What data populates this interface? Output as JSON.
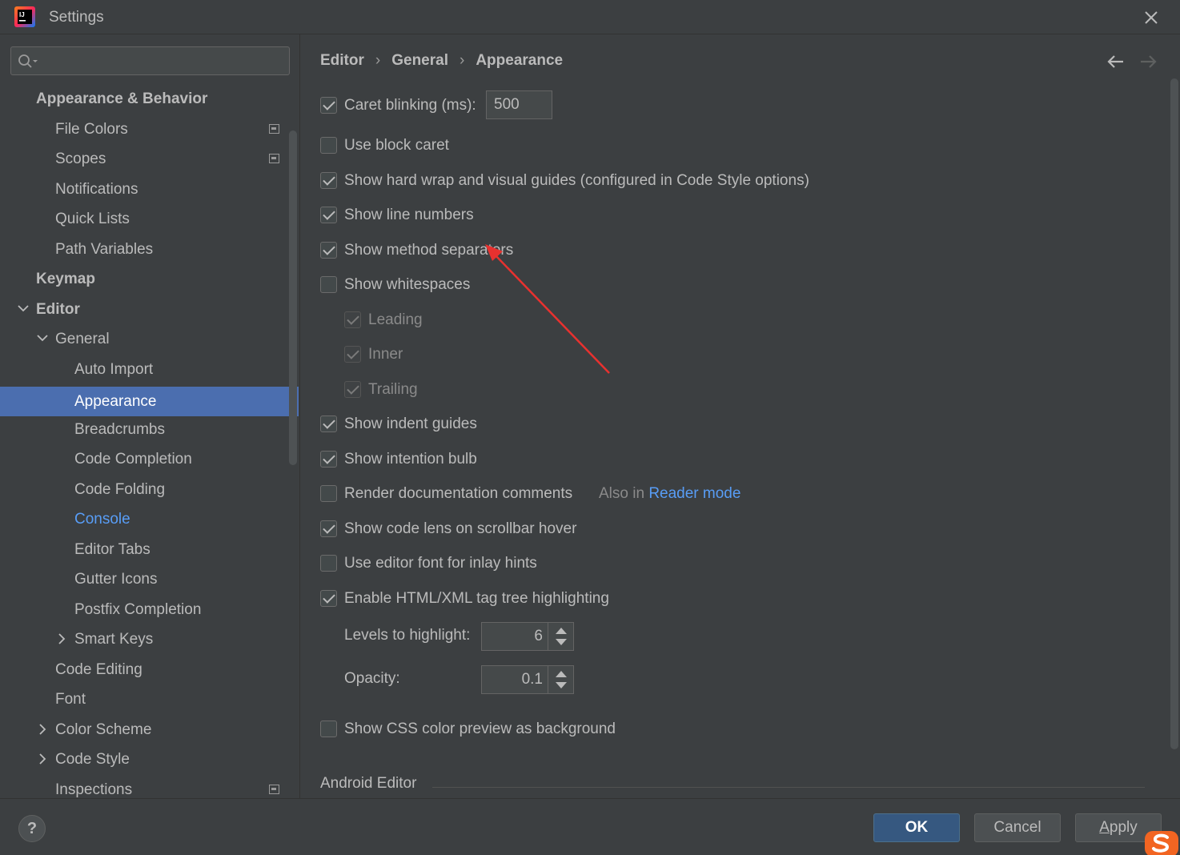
{
  "window": {
    "title": "Settings"
  },
  "sidebar": {
    "search_placeholder": "",
    "items": [
      {
        "label": "Appearance & Behavior",
        "level": 0,
        "bold": true
      },
      {
        "label": "File Colors",
        "level": 1,
        "project_icon": true
      },
      {
        "label": "Scopes",
        "level": 1,
        "project_icon": true
      },
      {
        "label": "Notifications",
        "level": 1
      },
      {
        "label": "Quick Lists",
        "level": 1
      },
      {
        "label": "Path Variables",
        "level": 1
      },
      {
        "label": "Keymap",
        "level": 0,
        "bold": true
      },
      {
        "label": "Editor",
        "level": 0,
        "bold": true,
        "expanded": true
      },
      {
        "label": "General",
        "level": 1,
        "expanded": true
      },
      {
        "label": "Auto Import",
        "level": 2
      },
      {
        "label": "Appearance",
        "level": 2,
        "selected": true
      },
      {
        "label": "Breadcrumbs",
        "level": 2
      },
      {
        "label": "Code Completion",
        "level": 2
      },
      {
        "label": "Code Folding",
        "level": 2
      },
      {
        "label": "Console",
        "level": 2,
        "link": true
      },
      {
        "label": "Editor Tabs",
        "level": 2
      },
      {
        "label": "Gutter Icons",
        "level": 2
      },
      {
        "label": "Postfix Completion",
        "level": 2
      },
      {
        "label": "Smart Keys",
        "level": 2,
        "collapsed": true
      },
      {
        "label": "Code Editing",
        "level": 1
      },
      {
        "label": "Font",
        "level": 1
      },
      {
        "label": "Color Scheme",
        "level": 1,
        "collapsed": true
      },
      {
        "label": "Code Style",
        "level": 1,
        "collapsed": true
      },
      {
        "label": "Inspections",
        "level": 1,
        "project_icon": true
      }
    ]
  },
  "breadcrumb": {
    "parts": [
      "Editor",
      "General",
      "Appearance"
    ],
    "separator": "›"
  },
  "options": {
    "caret_blinking": {
      "label": "Caret blinking (ms):",
      "checked": true,
      "value": "500"
    },
    "use_block_caret": {
      "label": "Use block caret",
      "checked": false
    },
    "hard_wrap": {
      "label": "Show hard wrap and visual guides (configured in Code Style options)",
      "checked": true
    },
    "line_numbers": {
      "label": "Show line numbers",
      "checked": true
    },
    "method_separators": {
      "label": "Show method separators",
      "checked": true
    },
    "whitespaces": {
      "label": "Show whitespaces",
      "checked": false
    },
    "leading": {
      "label": "Leading",
      "checked": true,
      "disabled": true
    },
    "inner": {
      "label": "Inner",
      "checked": true,
      "disabled": true
    },
    "trailing": {
      "label": "Trailing",
      "checked": true,
      "disabled": true
    },
    "indent_guides": {
      "label": "Show indent guides",
      "checked": true
    },
    "intention_bulb": {
      "label": "Show intention bulb",
      "checked": true
    },
    "render_docs": {
      "label": "Render documentation comments",
      "checked": false,
      "also_in": "Also in",
      "reader_mode": "Reader mode"
    },
    "code_lens": {
      "label": "Show code lens on scrollbar hover",
      "checked": true
    },
    "editor_font_inlay": {
      "label": "Use editor font for inlay hints",
      "checked": false
    },
    "tag_tree": {
      "label": "Enable HTML/XML tag tree highlighting",
      "checked": true
    },
    "levels": {
      "label": "Levels to highlight:",
      "value": "6"
    },
    "opacity": {
      "label": "Opacity:",
      "value": "0.1"
    },
    "css_preview": {
      "label": "Show CSS color preview as background",
      "checked": false
    }
  },
  "section": {
    "android_editor": "Android Editor"
  },
  "footer": {
    "help": "?",
    "ok": "OK",
    "cancel": "Cancel",
    "apply_underlined": "A",
    "apply_rest": "pply"
  },
  "colors": {
    "background": "#3c3f41",
    "selection": "#4b6eaf",
    "link": "#589df6",
    "annotation": "#e8312f"
  }
}
